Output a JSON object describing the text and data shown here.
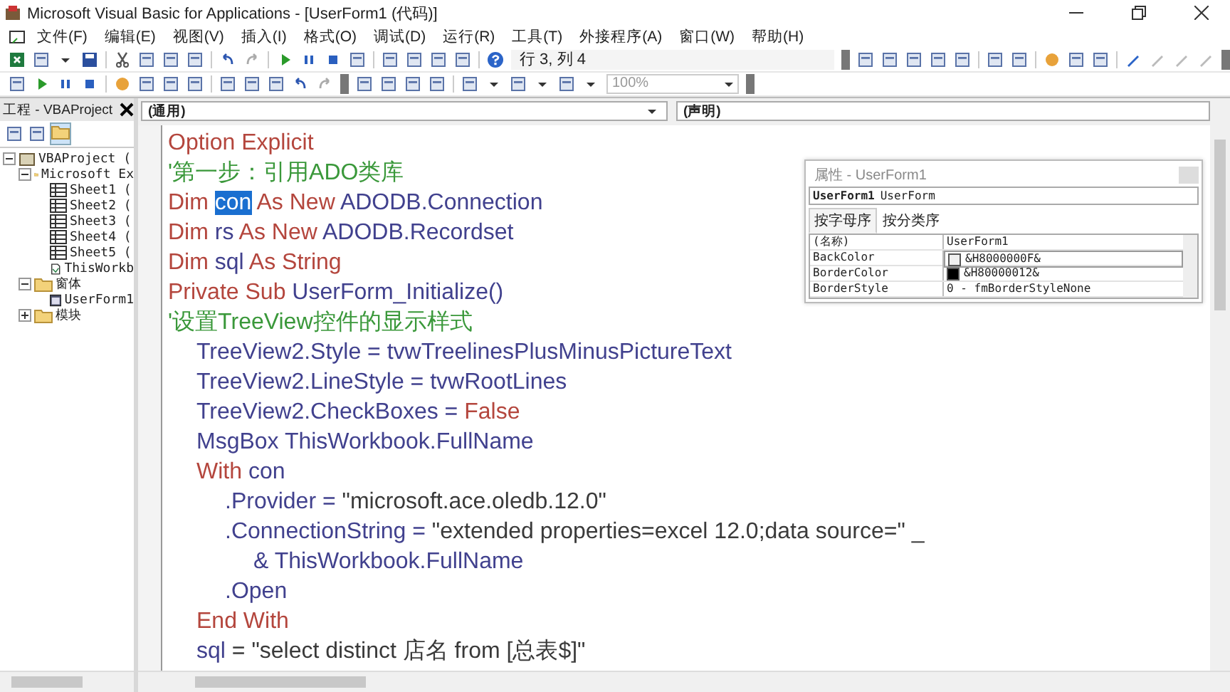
{
  "window": {
    "title": "Microsoft Visual Basic for Applications - [UserForm1 (代码)]"
  },
  "menu": [
    "文件(F)",
    "编辑(E)",
    "视图(V)",
    "插入(I)",
    "格式(O)",
    "调试(D)",
    "运行(R)",
    "工具(T)",
    "外接程序(A)",
    "窗口(W)",
    "帮助(H)"
  ],
  "toolbar": {
    "position": "行 3, 列 4",
    "zoom": "100%"
  },
  "project": {
    "title": "工程 - VBAProject",
    "tree": [
      {
        "label": "VBAProject (",
        "kind": "project",
        "expanded": true,
        "children": [
          {
            "label": "Microsoft Ex",
            "kind": "folder",
            "expanded": true,
            "children": [
              {
                "label": "Sheet1 (",
                "kind": "sheet"
              },
              {
                "label": "Sheet2 (",
                "kind": "sheet"
              },
              {
                "label": "Sheet3 (",
                "kind": "sheet"
              },
              {
                "label": "Sheet4 (",
                "kind": "sheet"
              },
              {
                "label": "Sheet5 (",
                "kind": "sheet"
              },
              {
                "label": "ThisWorkb",
                "kind": "workbook"
              }
            ]
          },
          {
            "label": "窗体",
            "kind": "folder",
            "expanded": true,
            "children": [
              {
                "label": "UserForm1",
                "kind": "form"
              }
            ]
          },
          {
            "label": "模块",
            "kind": "folder",
            "expanded": false
          }
        ]
      }
    ]
  },
  "code": {
    "object": "(通用)",
    "procedure": "(声明)",
    "lines": [
      {
        "segments": [
          {
            "kind": "keyword",
            "text": "Option Explicit"
          }
        ]
      },
      {
        "segments": [
          {
            "kind": "comment",
            "text": "'第一步：引用ADO类库"
          }
        ]
      },
      {
        "segments": [
          {
            "kind": "keyword",
            "text": "Dim "
          },
          {
            "kind": "selection",
            "text": "con"
          },
          {
            "kind": "keyword",
            "text": " As New "
          },
          {
            "kind": "name",
            "text": "ADODB.Connection"
          }
        ]
      },
      {
        "segments": [
          {
            "kind": "keyword",
            "text": "Dim "
          },
          {
            "kind": "name",
            "text": "rs"
          },
          {
            "kind": "keyword",
            "text": " As New "
          },
          {
            "kind": "name",
            "text": "ADODB.Recordset"
          }
        ]
      },
      {
        "segments": [
          {
            "kind": "keyword",
            "text": "Dim "
          },
          {
            "kind": "name",
            "text": "sql"
          },
          {
            "kind": "keyword",
            "text": " As String"
          }
        ]
      },
      {
        "segments": [
          {
            "kind": "keyword",
            "text": "Private Sub "
          },
          {
            "kind": "name",
            "text": "UserForm_Initialize()"
          }
        ]
      },
      {
        "segments": [
          {
            "kind": "comment",
            "text": "'设置TreeView控件的显示样式"
          }
        ],
        "children": [
          {
            "segments": [
              {
                "kind": "name",
                "text": "TreeView2.Style = tvwTreelinesPlusMinusPictureText"
              }
            ]
          },
          {
            "segments": [
              {
                "kind": "name",
                "text": "TreeView2.LineStyle = tvwRootLines"
              }
            ]
          },
          {
            "segments": [
              {
                "kind": "name",
                "text": "TreeView2.CheckBoxes = "
              },
              {
                "kind": "keyword",
                "text": "False"
              }
            ]
          },
          {
            "segments": [
              {
                "kind": "name",
                "text": "MsgBox ThisWorkbook.FullName"
              }
            ]
          },
          {
            "segments": [
              {
                "kind": "keyword",
                "text": "With "
              },
              {
                "kind": "name",
                "text": "con"
              }
            ],
            "children": [
              {
                "segments": [
                  {
                    "kind": "name",
                    "text": ".Provider = "
                  },
                  {
                    "kind": "string",
                    "text": "\"microsoft.ace.oledb.12.0\""
                  }
                ]
              },
              {
                "segments": [
                  {
                    "kind": "name",
                    "text": ".ConnectionString = "
                  },
                  {
                    "kind": "string",
                    "text": "\"extended properties=excel 12.0;data source=\" _"
                  }
                ],
                "children": [
                  {
                    "segments": [
                      {
                        "kind": "name",
                        "text": "& ThisWorkbook.FullName"
                      }
                    ]
                  }
                ]
              },
              {
                "segments": [
                  {
                    "kind": "name",
                    "text": ".Open"
                  }
                ]
              }
            ]
          },
          {
            "segments": [
              {
                "kind": "keyword",
                "text": "End With"
              }
            ]
          },
          {
            "segments": [
              {
                "kind": "name",
                "text": "sql"
              },
              {
                "kind": "string",
                "text": " = \"select distinct 店名 from [总表$]\""
              }
            ]
          }
        ]
      }
    ]
  },
  "properties": {
    "title": "属性 - UserForm1",
    "object_name": "UserForm1",
    "object_type": "UserForm",
    "tabs": [
      {
        "label": "按字母序",
        "selected": true
      },
      {
        "label": "按分类序",
        "selected": false
      }
    ],
    "rows": [
      {
        "name": "(名称)",
        "value": "UserForm1",
        "selected": false
      },
      {
        "name": "BackColor",
        "value": "&H8000000F&",
        "color": "#f0f0f0",
        "selected": true
      },
      {
        "name": "BorderColor",
        "value": "&H80000012&",
        "color": "#000000",
        "selected": false
      },
      {
        "name": "BorderStyle",
        "value": "0 - fmBorderStyleNone",
        "selected": false
      }
    ]
  }
}
